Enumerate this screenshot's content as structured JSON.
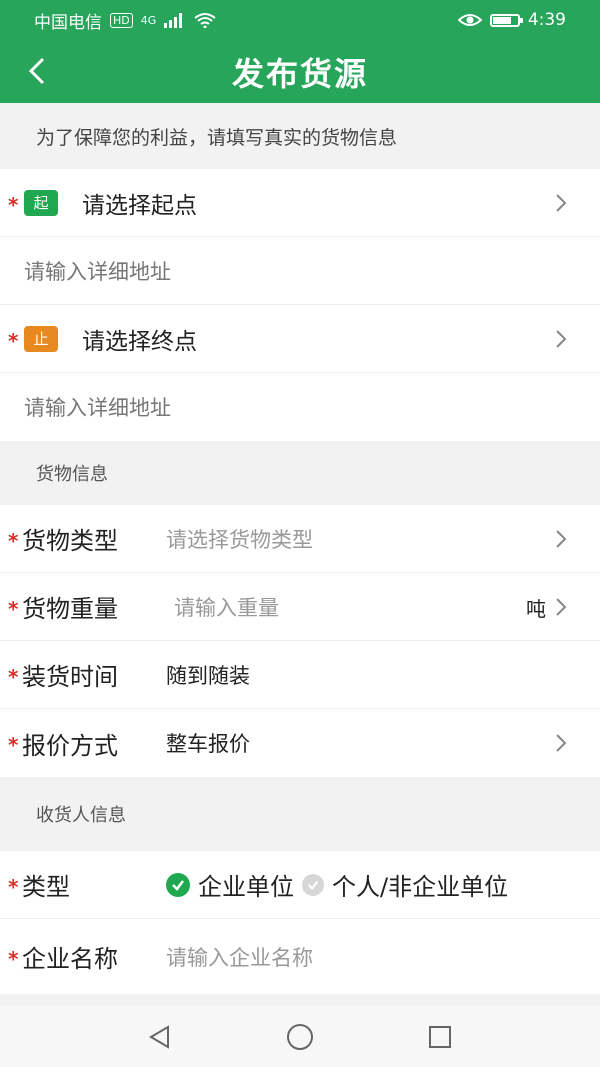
{
  "status": {
    "carrier": "中国电信",
    "hd": "HD",
    "network": "4G",
    "time": "4:39",
    "battery_level": 0.75
  },
  "header": {
    "title": "发布货源",
    "back_icon": "chevron-left-icon"
  },
  "notice": "为了保障您的利益，请填写真实的货物信息",
  "route": {
    "start": {
      "badge": "起",
      "label": "请选择起点",
      "address_placeholder": "请输入详细地址"
    },
    "end": {
      "badge": "止",
      "label": "请选择终点",
      "address_placeholder": "请输入详细地址"
    }
  },
  "cargo": {
    "section_title": "货物信息",
    "type": {
      "label": "货物类型",
      "placeholder": "请选择货物类型"
    },
    "weight": {
      "label": "货物重量",
      "placeholder": "请输入重量",
      "unit": "吨"
    },
    "load_time": {
      "label": "装货时间",
      "value": "随到随装"
    },
    "pricing": {
      "label": "报价方式",
      "value": "整车报价"
    }
  },
  "receiver": {
    "section_title": "收货人信息",
    "type": {
      "label": "类型",
      "options": [
        "企业单位",
        "个人/非企业单位"
      ],
      "selected": "企业单位"
    },
    "company": {
      "label": "企业名称",
      "placeholder": "请输入企业名称"
    }
  },
  "required_mark": "*",
  "colors": {
    "primary": "#27a55b",
    "required": "#d9302c",
    "start_badge": "#1fa84f",
    "end_badge": "#e8891f"
  }
}
